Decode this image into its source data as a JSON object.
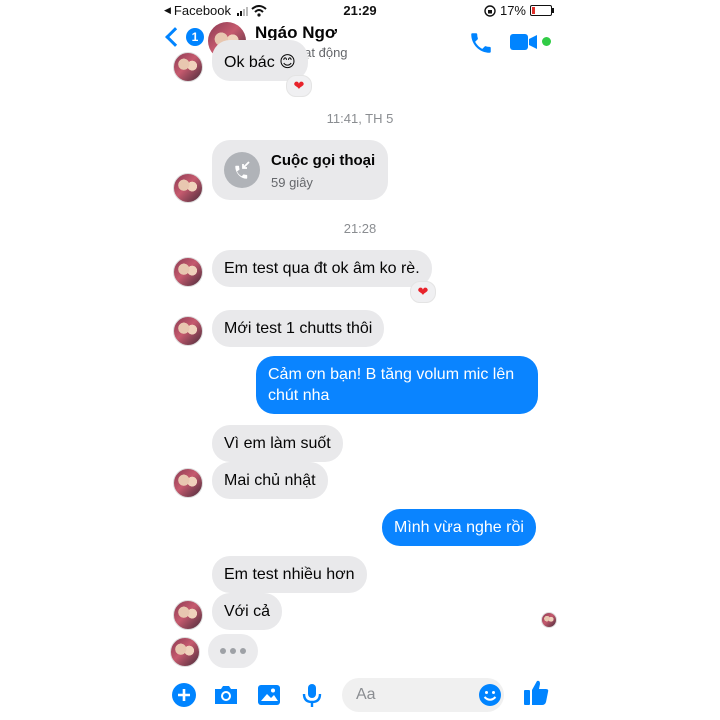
{
  "status_bar": {
    "carrier": "Facebook",
    "time": "21:29",
    "battery": "17%",
    "battery_level": 0.17
  },
  "header": {
    "back_badge": "1",
    "contact_name": "Ngáo Ngơ",
    "contact_status": "Đang hoạt động"
  },
  "messages": {
    "prev_text": "Ok bác 😊",
    "time1": "11:41, TH 5",
    "call_title": "Cuộc gọi thoại",
    "call_duration": "59 giây",
    "time2": "21:28",
    "m1": "Em test qua đt ok âm ko rè.",
    "m2": "Mới test 1 chutts thôi",
    "m3": "Cảm ơn bạn! B tăng volum mic lên chút nha",
    "m4": "Vì em làm suốt",
    "m5": "Mai chủ nhật",
    "m6": "Mình vừa nghe rồi",
    "m7": "Em test nhiều hơn",
    "m8": "Với cả",
    "reaction": "❤"
  },
  "composer": {
    "placeholder": "Aa"
  },
  "colors": {
    "accent": "#0084ff",
    "outgoing_bubble": "#0a84ff",
    "incoming_bubble": "#e9e9eb",
    "heart": "#e8232b"
  },
  "icons": [
    "back-chevron-icon",
    "phone-icon",
    "video-camera-icon",
    "online-dot-icon",
    "call-incoming-icon",
    "plus-icon",
    "camera-icon",
    "gallery-icon",
    "microphone-icon",
    "emoji-icon",
    "thumbs-up-icon"
  ]
}
